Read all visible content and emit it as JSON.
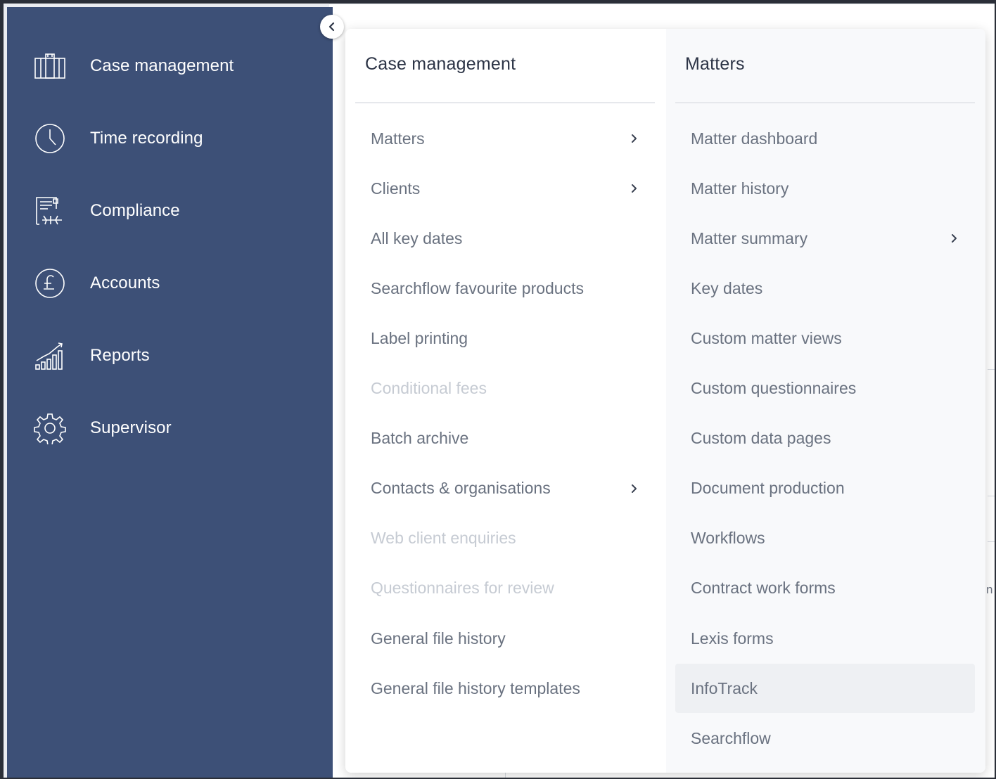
{
  "sidebar": {
    "items": [
      {
        "label": "Case management",
        "icon": "briefcase-icon"
      },
      {
        "label": "Time recording",
        "icon": "clock-icon"
      },
      {
        "label": "Compliance",
        "icon": "certificate-icon"
      },
      {
        "label": "Accounts",
        "icon": "pound-icon"
      },
      {
        "label": "Reports",
        "icon": "bar-chart-icon"
      },
      {
        "label": "Supervisor",
        "icon": "gear-icon"
      }
    ],
    "collapse_icon": "chevron-left-icon"
  },
  "flyout": {
    "left_heading": "Case management",
    "right_heading": "Matters",
    "left_items": [
      {
        "label": "Matters",
        "submenu": true,
        "disabled": false
      },
      {
        "label": "Clients",
        "submenu": true,
        "disabled": false
      },
      {
        "label": "All key dates",
        "submenu": false,
        "disabled": false
      },
      {
        "label": "Searchflow favourite products",
        "submenu": false,
        "disabled": false
      },
      {
        "label": "Label printing",
        "submenu": false,
        "disabled": false
      },
      {
        "label": "Conditional fees",
        "submenu": false,
        "disabled": true
      },
      {
        "label": "Batch archive",
        "submenu": false,
        "disabled": false
      },
      {
        "label": "Contacts & organisations",
        "submenu": true,
        "disabled": false
      },
      {
        "label": "Web client enquiries",
        "submenu": false,
        "disabled": true
      },
      {
        "label": "Questionnaires for review",
        "submenu": false,
        "disabled": true
      },
      {
        "label": "General file history",
        "submenu": false,
        "disabled": false
      },
      {
        "label": "General file history templates",
        "submenu": false,
        "disabled": false
      }
    ],
    "right_items": [
      {
        "label": "Matter dashboard",
        "submenu": false,
        "active": false
      },
      {
        "label": "Matter history",
        "submenu": false,
        "active": false
      },
      {
        "label": "Matter summary",
        "submenu": true,
        "active": false
      },
      {
        "label": "Key dates",
        "submenu": false,
        "active": false
      },
      {
        "label": "Custom matter views",
        "submenu": false,
        "active": false
      },
      {
        "label": "Custom questionnaires",
        "submenu": false,
        "active": false
      },
      {
        "label": "Custom data pages",
        "submenu": false,
        "active": false
      },
      {
        "label": "Document production",
        "submenu": false,
        "active": false
      },
      {
        "label": "Workflows",
        "submenu": false,
        "active": false
      },
      {
        "label": "Contract work forms",
        "submenu": false,
        "active": false
      },
      {
        "label": "Lexis forms",
        "submenu": false,
        "active": false
      },
      {
        "label": "InfoTrack",
        "submenu": false,
        "active": true
      },
      {
        "label": "Searchflow",
        "submenu": false,
        "active": false
      }
    ]
  },
  "background": {
    "peek_text": "n"
  },
  "colors": {
    "sidebar_bg": "#3d5077",
    "menu_text": "#6a7280",
    "menu_disabled": "#c6cbd3",
    "heading_text": "#2c3446"
  }
}
